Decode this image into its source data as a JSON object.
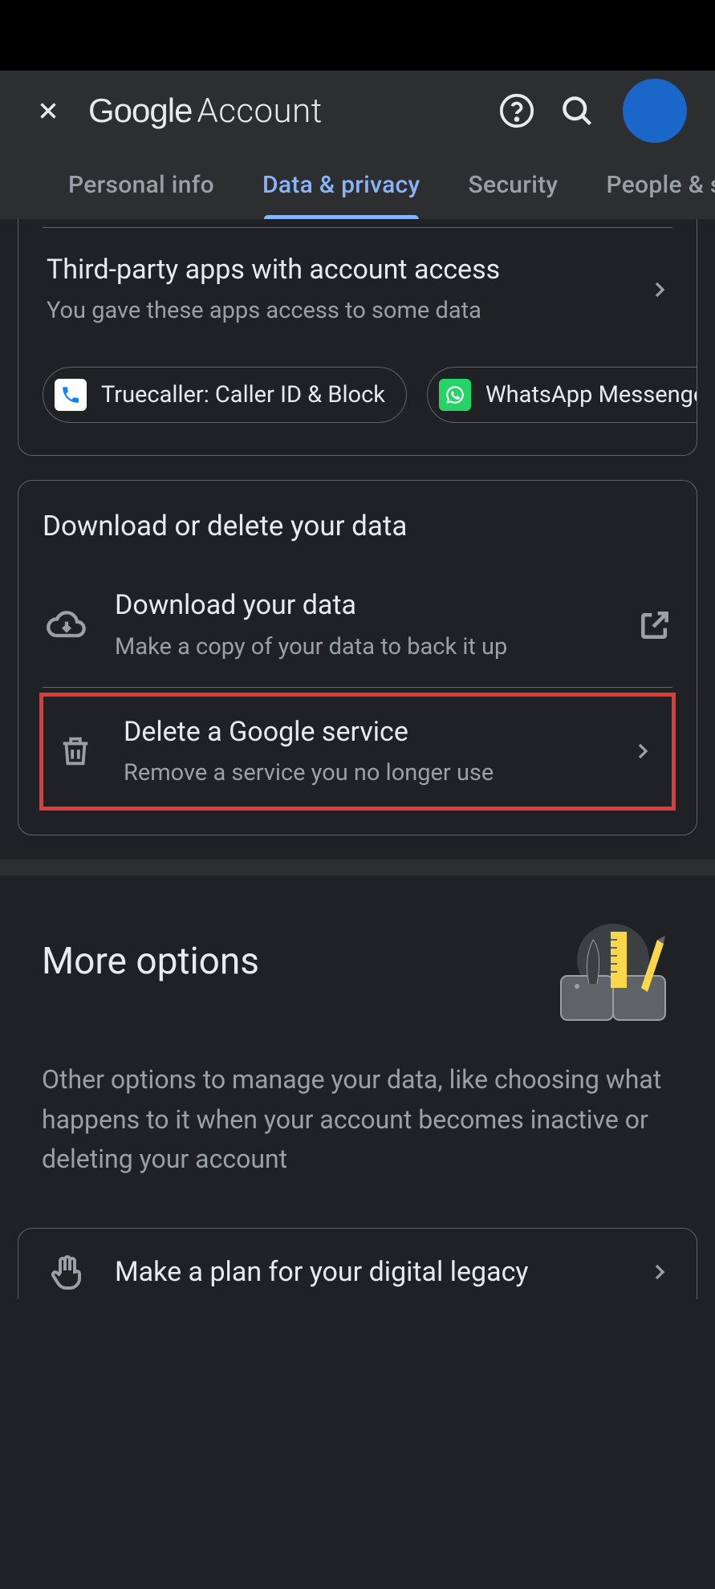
{
  "header": {
    "brand_google": "Google",
    "brand_account": "Account"
  },
  "tabs": {
    "personal": "Personal info",
    "data_privacy": "Data & privacy",
    "security": "Security",
    "people": "People & sharing"
  },
  "third_party": {
    "title": "Third-party apps with account access",
    "subtitle": "You gave these apps access to some data",
    "chips": {
      "truecaller": "Truecaller: Caller ID & Block",
      "whatsapp": "WhatsApp Messenger"
    }
  },
  "download_delete": {
    "heading": "Download or delete your data",
    "download": {
      "title": "Download your data",
      "subtitle": "Make a copy of your data to back it up"
    },
    "delete_service": {
      "title": "Delete a Google service",
      "subtitle": "Remove a service you no longer use"
    }
  },
  "more_options": {
    "heading": "More options",
    "description": "Other options to manage your data, like choosing what happens to it when your account becomes inactive or deleting your account",
    "digital_legacy": {
      "title": "Make a plan for your digital legacy"
    }
  }
}
